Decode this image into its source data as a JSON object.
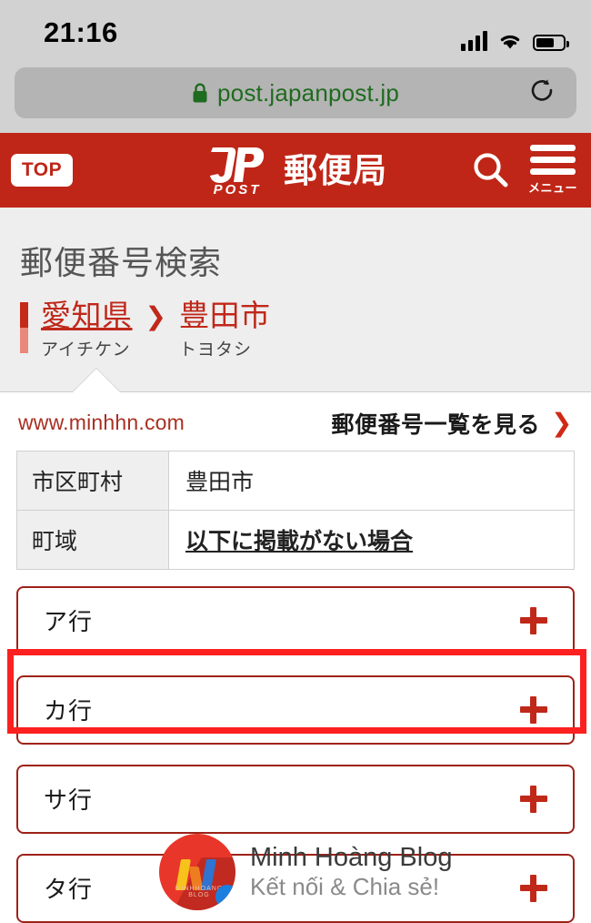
{
  "status_bar": {
    "time": "21:16",
    "signal_icon": "signal-bars-icon",
    "wifi_icon": "wifi-icon",
    "battery_icon": "battery-icon"
  },
  "browser": {
    "lock_icon": "lock-icon",
    "url": "post.japanpost.jp",
    "reload_icon": "reload-icon"
  },
  "site_header": {
    "top_button": "TOP",
    "logo_mark": "jp-post-logo",
    "logo_sub": "POST",
    "brand_name": "郵便局",
    "search_icon": "search-icon",
    "menu_icon": "hamburger-menu-icon",
    "menu_label": "メニュー",
    "background_color": "#bf2617"
  },
  "page": {
    "title": "郵便番号検索",
    "breadcrumb": [
      {
        "label": "愛知県",
        "kana": "アイチケン",
        "is_link": true
      },
      {
        "label": "豊田市",
        "kana": "トヨタシ",
        "is_link": false
      }
    ],
    "breadcrumb_separator": "＞"
  },
  "meta": {
    "watermark_url": "www.minhhn.com",
    "list_link_label": "郵便番号一覧を見る",
    "list_link_chevron": "❯"
  },
  "info_table": {
    "rows": [
      {
        "header": "市区町村",
        "value": "豊田市",
        "emphasis": false
      },
      {
        "header": "町域",
        "value": "以下に掲載がない場合",
        "emphasis": true
      }
    ]
  },
  "accordions": [
    {
      "label": "ア行",
      "icon": "plus-icon",
      "highlighted": false
    },
    {
      "label": "カ行",
      "icon": "plus-icon",
      "highlighted": true
    },
    {
      "label": "サ行",
      "icon": "plus-icon",
      "highlighted": false
    },
    {
      "label": "タ行",
      "icon": "plus-icon",
      "highlighted": false
    }
  ],
  "annotation": {
    "highlight_color": "#fc2020",
    "target": "カ行"
  },
  "blog_watermark": {
    "logo_icon": "minh-hoang-blog-logo",
    "logo_caption": "MINHHOANG BLOG",
    "title": "Minh Hoàng Blog",
    "tagline": "Kết nối & Chia sẻ!"
  },
  "colors": {
    "brand_red": "#bf2617",
    "link_red": "#c0281a",
    "url_green": "#1f6b1f",
    "chrome_gray": "#d2d2d2"
  }
}
